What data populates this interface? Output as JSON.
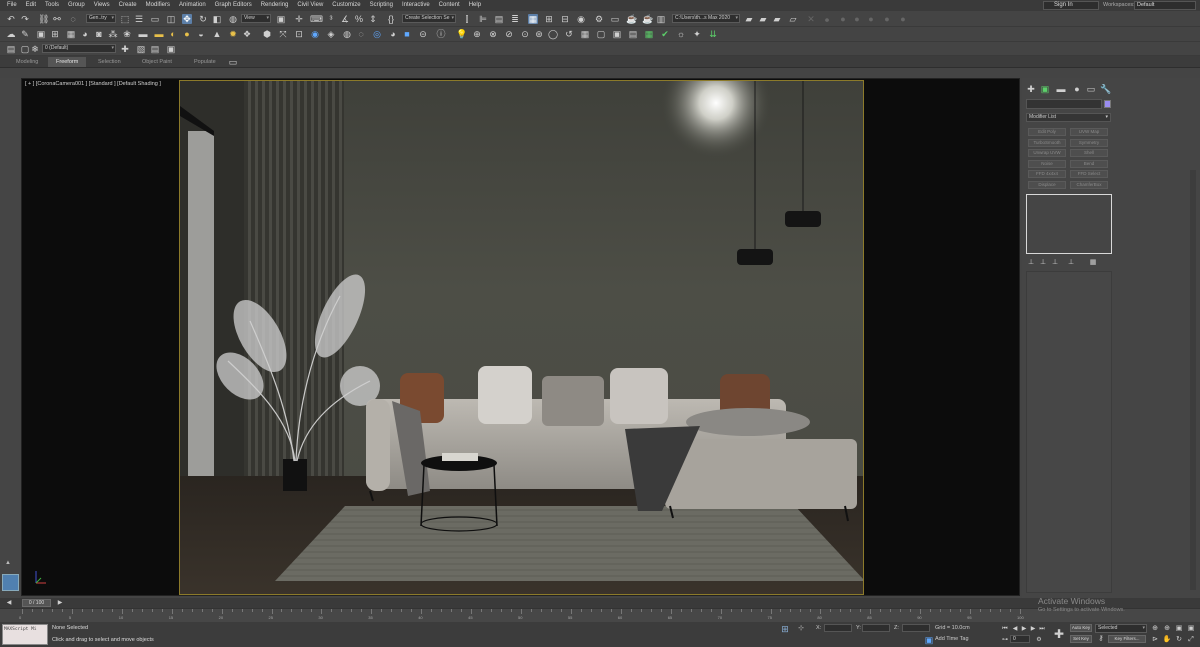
{
  "menu": {
    "items": [
      "File",
      "Edit",
      "Tools",
      "Group",
      "Views",
      "Create",
      "Modifiers",
      "Animation",
      "Graph Editors",
      "Rendering",
      "Civil View",
      "Customize",
      "Scripting",
      "Interactive",
      "Content",
      "Help"
    ],
    "sign_in": "Sign In",
    "workspaces_label": "Workspaces:",
    "workspace_value": "Default"
  },
  "toolbar": {
    "selection_filter": "Gen..try",
    "reference_coord": "View",
    "named_selection": "Create Selection Se",
    "project_path": "C:\\Users\\th...s Max 2020",
    "layer_name": "0 (Default)"
  },
  "ribbon": {
    "tabs": [
      "Modeling",
      "Freeform",
      "Selection",
      "Object Paint",
      "Populate"
    ],
    "active_tab": "Freeform"
  },
  "viewport": {
    "label": "[ + ] [CoronaCamera001 ] [Standard ] [Default Shading ]"
  },
  "command_panel": {
    "modifier_list": "Modifier List",
    "buttons": [
      "Edit Poly",
      "UVW Map",
      "TurboSmooth",
      "Symmetry",
      "Unwrap UVW",
      "Shell",
      "Noise",
      "Bend",
      "FFD 4x4x4",
      "FFD Select",
      "Displace",
      "ChamferBox"
    ]
  },
  "timeline": {
    "frame": "0 / 100",
    "ticks": [
      "0",
      "5",
      "10",
      "15",
      "20",
      "25",
      "30",
      "35",
      "40",
      "45",
      "50",
      "55",
      "60",
      "65",
      "70",
      "75",
      "80",
      "85",
      "90",
      "95",
      "100"
    ]
  },
  "status": {
    "script_text": "MAXScript Mi",
    "selected": "None Selected",
    "prompt": "Click and drag to select and move objects",
    "x_label": "X:",
    "y_label": "Y:",
    "z_label": "Z:",
    "grid": "Grid = 10.0cm",
    "add_time_tag": "Add Time Tag",
    "auto_key": "Auto Key",
    "set_key": "Set Key",
    "key_filter": "Selected",
    "key_filters": "Key Filters...",
    "frame_field": "0"
  },
  "watermark": {
    "title": "Activate Windows",
    "subtitle": "Go to Settings to activate Windows."
  }
}
